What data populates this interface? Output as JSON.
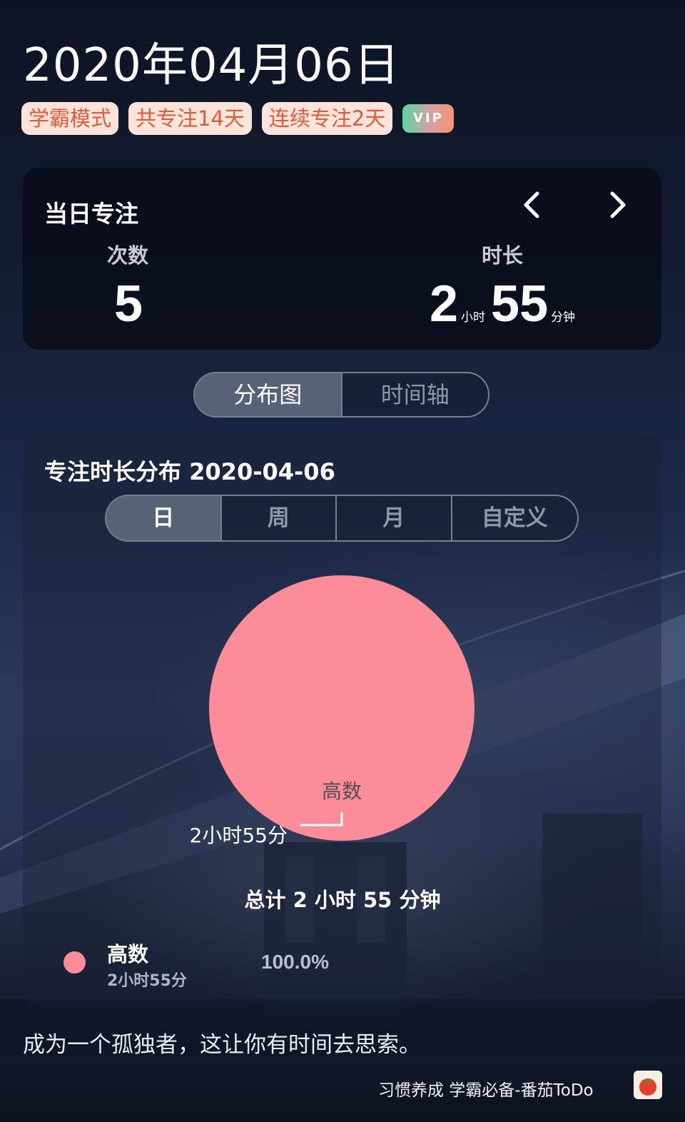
{
  "header": {
    "date": "2020年04月06日",
    "tags": [
      "学霸模式",
      "共专注14天",
      "连续专注2天"
    ],
    "vip_label": "VIP"
  },
  "daily_focus": {
    "title": "当日专注",
    "count_label": "次数",
    "count_value": "5",
    "duration_label": "时长",
    "hours": "2",
    "hours_unit": "小时",
    "minutes": "55",
    "minutes_unit": "分钟",
    "prev_icon": "chevron-left-icon",
    "next_icon": "chevron-right-icon"
  },
  "view_tabs": {
    "items": [
      "分布图",
      "时间轴"
    ],
    "active": 0
  },
  "distribution": {
    "title": "专注时长分布  2020-04-06",
    "range_tabs": {
      "items": [
        "日",
        "周",
        "月",
        "自定义"
      ],
      "active": 0
    },
    "total_text": "总计 2 小时 55 分钟"
  },
  "chart_data": {
    "type": "pie",
    "slices": [
      {
        "label": "高数",
        "value_minutes": 175,
        "value_text": "2小时55分",
        "percent": 100.0,
        "percent_text": "100.0%",
        "color": "#fc8c98"
      }
    ]
  },
  "quote": "成为一个孤独者，这让你有时间去思索。",
  "footer": {
    "text": "习惯养成 学霸必备-番茄ToDo",
    "icon": "tomato-icon"
  },
  "colors": {
    "tag_bg": "#fde3da",
    "tag_text": "#e05b3c",
    "slice": "#fc8c98"
  }
}
